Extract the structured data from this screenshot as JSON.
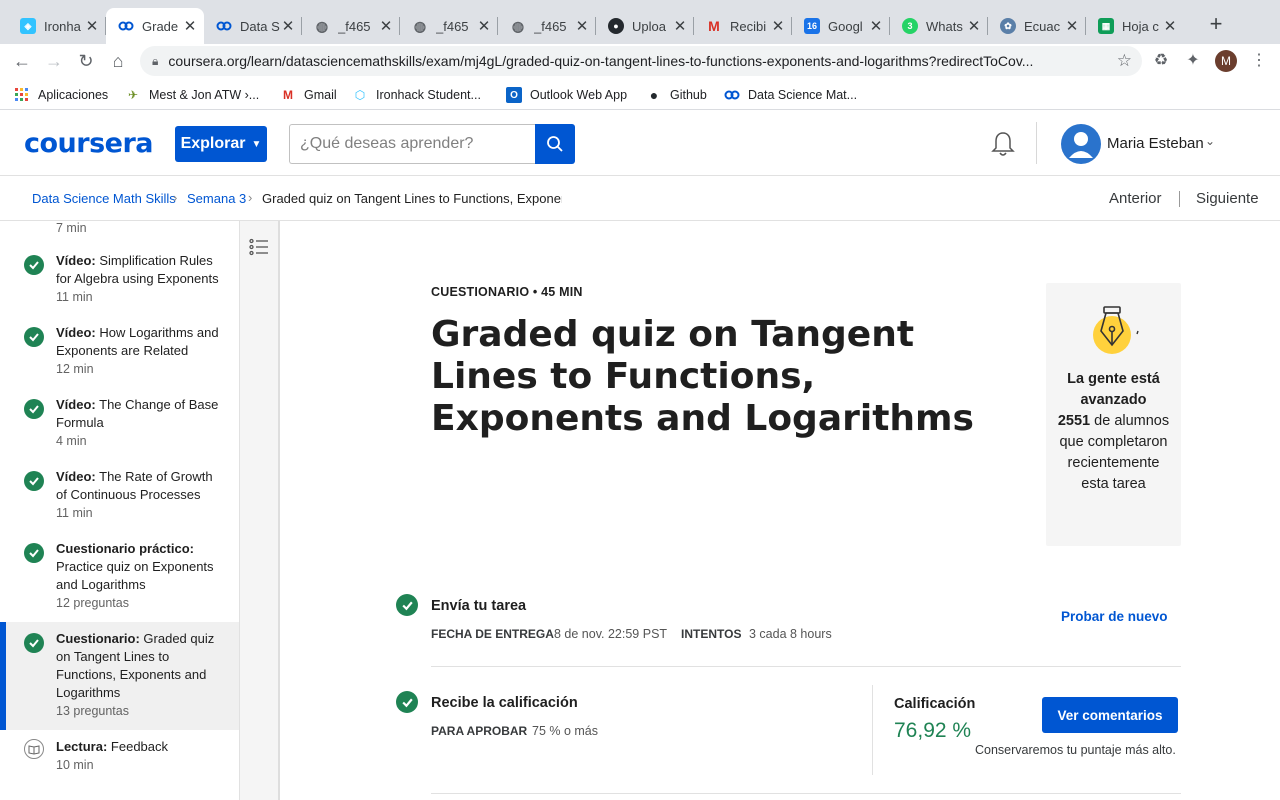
{
  "browser": {
    "tabs": [
      {
        "label": "Ironha",
        "icon": "ironhack-favicon",
        "color": "#32c3ff"
      },
      {
        "label": "Grade",
        "icon": "coursera-favicon",
        "color": "#0056d2"
      },
      {
        "label": "Data S",
        "icon": "coursera-favicon",
        "color": "#0056d2"
      },
      {
        "label": "_f465",
        "icon": "globe-icon",
        "color": "#5f6368"
      },
      {
        "label": "_f465",
        "icon": "globe-icon",
        "color": "#5f6368"
      },
      {
        "label": "_f465",
        "icon": "globe-icon",
        "color": "#5f6368"
      },
      {
        "label": "Uploa",
        "icon": "github-icon",
        "color": "#24292e"
      },
      {
        "label": "Recibi",
        "icon": "gmail-icon",
        "color": "#d93025"
      },
      {
        "label": "Googl",
        "icon": "google-calendar-icon",
        "color": "#1a73e8"
      },
      {
        "label": "Whats",
        "icon": "whatsapp-icon",
        "color": "#25d366"
      },
      {
        "label": "Ecuac",
        "icon": "gear-globe-icon",
        "color": "#5a7fa8"
      },
      {
        "label": "Hoja c",
        "icon": "google-sheets-icon",
        "color": "#0f9d58"
      }
    ],
    "calendar_badge": "16",
    "whatsapp_badge": "3",
    "url": "coursera.org/learn/datasciencemathskills/exam/mj4gL/graded-quiz-on-tangent-lines-to-functions-exponents-and-logarithms?redirectToCov...",
    "profile_initial": "M",
    "bookmarks": [
      {
        "label": "Aplicaciones",
        "icon": "apps-grid-icon"
      },
      {
        "label": "Mest & Jon ATW ›...",
        "icon": "map-icon"
      },
      {
        "label": "Gmail",
        "icon": "gmail-icon"
      },
      {
        "label": "Ironhack Student...",
        "icon": "ironhack-icon"
      },
      {
        "label": "Outlook Web App",
        "icon": "outlook-icon"
      },
      {
        "label": "Github",
        "icon": "github-icon"
      },
      {
        "label": "Data Science Mat...",
        "icon": "coursera-icon"
      }
    ]
  },
  "header": {
    "logo": "coursera",
    "explore_label": "Explorar",
    "search_placeholder": "¿Qué deseas aprender?",
    "user_name": "Maria Esteban"
  },
  "breadcrumb": {
    "items": [
      "Data Science Math Skills",
      "Semana 3",
      "Graded quiz on Tangent Lines to Functions, Exponents and Logarithms"
    ],
    "prev": "Anterior",
    "next": "Siguiente"
  },
  "sidebar": {
    "top_meta": "7 min",
    "items": [
      {
        "type": "Vídeo:",
        "title": "Simplification Rules for Algebra using Exponents",
        "meta": "11 min"
      },
      {
        "type": "Vídeo:",
        "title": "How Logarithms and Exponents are Related",
        "meta": "12 min"
      },
      {
        "type": "Vídeo:",
        "title": "The Change of Base Formula",
        "meta": "4 min"
      },
      {
        "type": "Vídeo:",
        "title": "The Rate of Growth of Continuous Processes",
        "meta": "11 min"
      },
      {
        "type": "Cuestionario práctico:",
        "title": "Practice quiz on Exponents and Logarithms",
        "meta": "12 preguntas"
      },
      {
        "type": "Cuestionario:",
        "title": "Graded quiz on Tangent Lines to Functions, Exponents and Logarithms",
        "meta": "13 preguntas"
      },
      {
        "type": "Lectura:",
        "title": "Feedback",
        "meta": "10 min"
      }
    ]
  },
  "main": {
    "kicker": "CUESTIONARIO • 45 MIN",
    "title": "Graded quiz on Tangent Lines to Functions, Exponents and Logarithms",
    "stats": {
      "line1": "La gente está avanzado",
      "count": "2551",
      "line2": "de alumnos que completaron recientemente esta tarea"
    },
    "submit": {
      "heading": "Envía tu tarea",
      "due_label": "FECHA DE ENTREGA",
      "due_value": "8 de nov. 22:59 PST",
      "attempts_label": "INTENTOS",
      "attempts_value": "3 cada 8 hours",
      "retry": "Probar de nuevo"
    },
    "grade": {
      "heading": "Recibe la calificación",
      "pass_label": "PARA APROBAR",
      "pass_value": "75 % o más",
      "grade_label": "Calificación",
      "grade_value": "76,92 %",
      "button": "Ver comentarios",
      "note": "Conservaremos tu puntaje más alto."
    }
  },
  "colors": {
    "brand": "#0056d2",
    "success": "#1f8354"
  }
}
